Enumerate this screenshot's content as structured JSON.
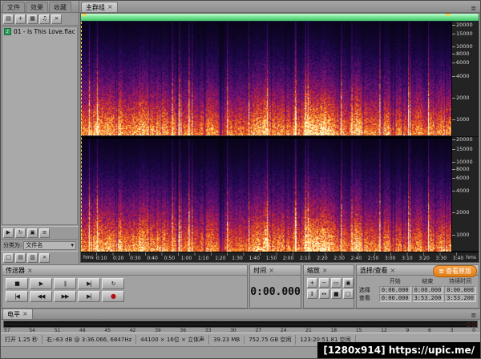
{
  "ui": {
    "close_glyph": "×",
    "menu_glyph": "≣",
    "dropdown_glyph": "▾"
  },
  "left_panel": {
    "tabs": [
      {
        "name": "tab-files",
        "label": "文件"
      },
      {
        "name": "tab-effects",
        "label": "效果"
      },
      {
        "name": "tab-favorites",
        "label": "收藏"
      }
    ],
    "toolbar": [
      {
        "name": "import-file-button",
        "glyph": "▤"
      },
      {
        "name": "open-file-button",
        "glyph": "+"
      },
      {
        "name": "edit-file-button",
        "glyph": "▦"
      },
      {
        "name": "insert-to-multitrack-button",
        "glyph": "♫"
      },
      {
        "name": "close-file-button",
        "glyph": "×"
      }
    ],
    "files": [
      {
        "label": "01 - Is This Love.flac"
      }
    ],
    "controls_row": [
      {
        "name": "play-file-button",
        "glyph": "▶"
      },
      {
        "name": "loop-play-button",
        "glyph": "↻"
      },
      {
        "name": "auto-play-toggle",
        "glyph": "▣"
      },
      {
        "name": "panel-options-button",
        "glyph": "≡"
      }
    ],
    "sort_label": "分类为:",
    "sort_value": "文件名",
    "folder_row": [
      {
        "name": "new-folder-button",
        "glyph": "□"
      },
      {
        "name": "expand-all-button",
        "glyph": "▤"
      },
      {
        "name": "collapse-all-button",
        "glyph": "▥"
      },
      {
        "name": "remove-file-button",
        "glyph": "×"
      }
    ]
  },
  "main_panel": {
    "tab": "主群组",
    "freq_labels": [
      "20000",
      "15000",
      "10000",
      "8000",
      "6000",
      "4000",
      "2000",
      "1000"
    ],
    "time_ruler": {
      "unit": "hms",
      "labels": [
        "0:10",
        "0:20",
        "0:30",
        "0:40",
        "0:50",
        "1:00",
        "1:10",
        "1:20",
        "1:30",
        "1:40",
        "1:50",
        "2:00",
        "2:10",
        "2:20",
        "2:30",
        "2:40",
        "2:50",
        "3:00",
        "3:10",
        "3:20",
        "3:30",
        "3:40"
      ]
    }
  },
  "transport": {
    "title": "传送器",
    "row1": [
      {
        "name": "stop-button",
        "glyph": "■"
      },
      {
        "name": "play-button",
        "glyph": "▶"
      },
      {
        "name": "pause-button",
        "glyph": "∥"
      },
      {
        "name": "play-from-cursor-button",
        "glyph": "▶|"
      },
      {
        "name": "play-looped-button",
        "glyph": "↻"
      }
    ],
    "row2": [
      {
        "name": "go-to-beginning-button",
        "glyph": "|◀"
      },
      {
        "name": "rewind-button",
        "glyph": "◀◀"
      },
      {
        "name": "fast-forward-button",
        "glyph": "▶▶"
      },
      {
        "name": "go-to-end-button",
        "glyph": "▶|"
      },
      {
        "name": "record-button",
        "glyph": "●"
      }
    ]
  },
  "time_panel": {
    "title": "时间",
    "value": "0:00.000"
  },
  "zoom_panel": {
    "title": "缩放",
    "buttons": [
      {
        "name": "zoom-in-button",
        "glyph": "+"
      },
      {
        "name": "zoom-out-button",
        "glyph": "−"
      },
      {
        "name": "zoom-to-selection-button",
        "glyph": "▭"
      },
      {
        "name": "zoom-full-button",
        "glyph": "▣"
      },
      {
        "name": "zoom-in-vertical-button",
        "glyph": "↕"
      },
      {
        "name": "zoom-out-vertical-button",
        "glyph": "↔"
      },
      {
        "name": "zoom-left-edge-button",
        "glyph": "■"
      },
      {
        "name": "zoom-right-edge-button",
        "glyph": "□"
      }
    ]
  },
  "selection_panel": {
    "title": "选择/查看",
    "col_headers": [
      "开始",
      "结束",
      "持续时间"
    ],
    "rows": [
      {
        "name": "selection-row",
        "label": "选择",
        "start": "0:00.000",
        "end": "0:00.000",
        "duration": "0:00.000"
      },
      {
        "name": "view-row",
        "label": "查看",
        "start": "0:00.000",
        "end": "3:53.200",
        "duration": "3:53.200"
      }
    ],
    "badge": "查看原版"
  },
  "levels": {
    "title": "电平",
    "scale": [
      "57",
      "54",
      "51",
      "48",
      "45",
      "42",
      "39",
      "36",
      "33",
      "30",
      "27",
      "24",
      "21",
      "18",
      "15",
      "12",
      "9",
      "6",
      "3",
      "0"
    ]
  },
  "status": {
    "items": [
      "打开 1.25 秒",
      "右:-63 dB @ 3:36.066, 6847Hz",
      "44100 × 16位 × 立体声",
      "39.23 MB",
      "752.75 GB 空闲",
      "123:20:51.81 空闲"
    ]
  },
  "watermark": "[1280x914] https://upic.me/"
}
